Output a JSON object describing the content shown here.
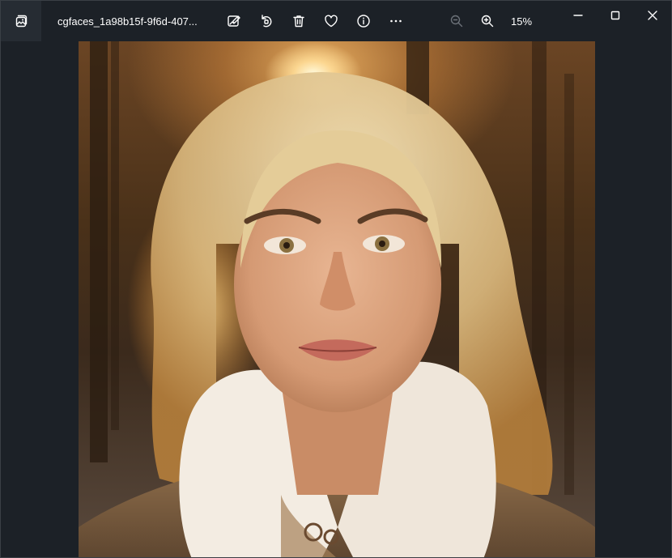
{
  "window": {
    "title": "cgfaces_1a98b15f-9f6d-407...",
    "zoom_level": "15%"
  },
  "toolbar": {
    "buttons": [
      "edit-image-icon",
      "rotate-icon",
      "delete-icon",
      "favorite-icon",
      "info-icon",
      "more-icon"
    ]
  },
  "zoom": {
    "buttons": [
      "zoom-out-icon",
      "zoom-in-icon"
    ]
  },
  "colors": {
    "background": "#1c2127",
    "titlebar_active": "#262c33",
    "icon": "#ffffff",
    "icon_disabled": "#6b7178"
  }
}
